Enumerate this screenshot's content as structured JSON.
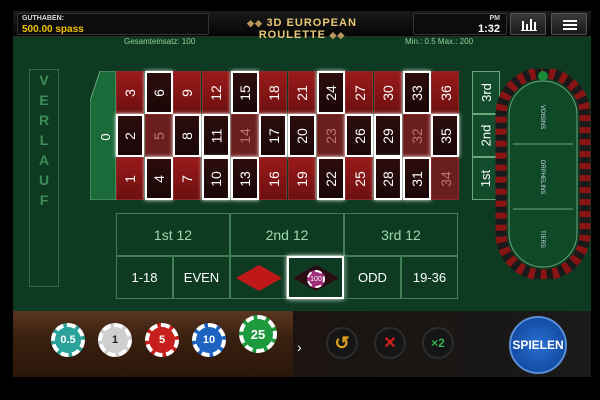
{
  "balance": {
    "label": "GUTHABEN:",
    "value": "500.00 spass"
  },
  "title": "3D EUROPEAN ROULETTE",
  "clock": {
    "ampm": "PM",
    "time": "1:32"
  },
  "info": {
    "total": "Gesamteinsatz: 100",
    "limits": "Min.: 0.5 Max.: 200"
  },
  "history": {
    "letters": [
      "V",
      "E",
      "R",
      "L",
      "A",
      "U",
      "F"
    ]
  },
  "board": {
    "zero": "0",
    "top_row": [
      "3",
      "6",
      "9",
      "12",
      "15",
      "18",
      "21",
      "24",
      "27",
      "30",
      "33",
      "36"
    ],
    "mid_row": [
      "2",
      "5",
      "8",
      "11",
      "14",
      "17",
      "20",
      "23",
      "26",
      "29",
      "32",
      "35"
    ],
    "bottom_row": [
      "1",
      "4",
      "7",
      "10",
      "13",
      "16",
      "19",
      "22",
      "25",
      "28",
      "31",
      "34"
    ],
    "columns": [
      "3rd",
      "2nd",
      "1st"
    ],
    "dozens": [
      "1st 12",
      "2nd 12",
      "3rd 12"
    ],
    "outside": [
      "1-18",
      "EVEN",
      "",
      "",
      "ODD",
      "19-36"
    ],
    "placed_bet": "100"
  },
  "racetrack": {
    "labels": [
      "VOISINS",
      "ORPHELINS",
      "TIERS"
    ],
    "zero": "0"
  },
  "chips": [
    {
      "value": "0.5",
      "color": "#2aa39a"
    },
    {
      "value": "1",
      "color": "#cfcfcf"
    },
    {
      "value": "5",
      "color": "#c81e1e"
    },
    {
      "value": "10",
      "color": "#1d63c2"
    },
    {
      "value": "25",
      "color": "#1d9a3e"
    }
  ],
  "controls": {
    "repeat_icon": "↺",
    "clear_icon": "✕",
    "double_label": "×2"
  },
  "spin_label": "SPIELEN",
  "colors": {
    "felt": "#0e3a22",
    "gold": "#f2c200",
    "red": "#9a1a1a",
    "black": "#2c0d0d"
  }
}
